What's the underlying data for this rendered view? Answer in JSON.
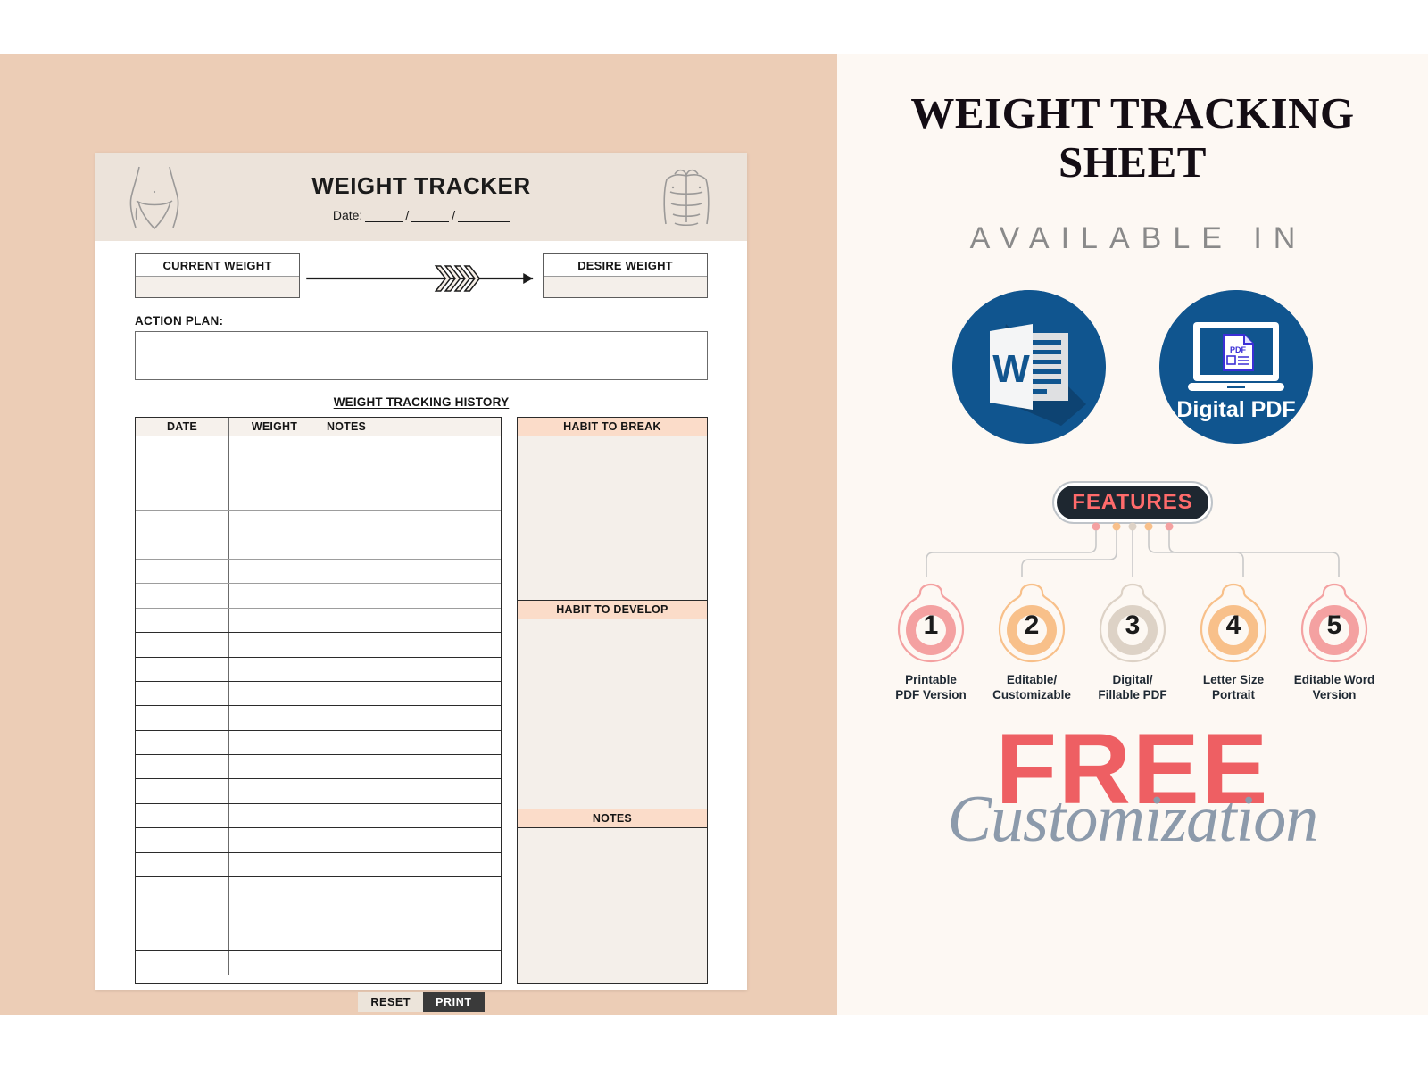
{
  "sheet": {
    "title": "WEIGHT TRACKER",
    "date_label": "Date:",
    "date_sep": "/",
    "current_weight_label": "CURRENT WEIGHT",
    "desire_weight_label": "DESIRE WEIGHT",
    "action_plan_label": "ACTION PLAN:",
    "history_title": "WEIGHT TRACKING HISTORY",
    "table": {
      "columns": [
        "DATE",
        "WEIGHT",
        "NOTES"
      ],
      "row_count": 22,
      "rows": []
    },
    "side_panels": [
      {
        "caption": "HABIT TO BREAK"
      },
      {
        "caption": "HABIT TO DEVELOP"
      },
      {
        "caption": "NOTES"
      }
    ],
    "buttons": {
      "reset": "RESET",
      "print": "PRINT"
    },
    "icons": {
      "left": "female-body-silhouette-icon",
      "right": "male-abs-silhouette-icon"
    }
  },
  "promo": {
    "title_line1": "WEIGHT TRACKING",
    "title_line2": "SHEET",
    "subtitle": "AVAILABLE IN",
    "format_badges": [
      {
        "name": "word-doc-icon",
        "letter": "W",
        "label": ""
      },
      {
        "name": "digital-pdf-icon",
        "letter": "PDF",
        "label": "Digital PDF"
      }
    ],
    "features_label": "FEATURES",
    "features": [
      {
        "number": "1",
        "label_line1": "Printable",
        "label_line2": "PDF Version",
        "color": "#f4a1a1"
      },
      {
        "number": "2",
        "label_line1": "Editable/",
        "label_line2": "Customizable",
        "color": "#f8c08a"
      },
      {
        "number": "3",
        "label_line1": "Digital/",
        "label_line2": "Fillable PDF",
        "color": "#ddd2c6"
      },
      {
        "number": "4",
        "label_line1": "Letter Size",
        "label_line2": "Portrait",
        "color": "#f8c08a"
      },
      {
        "number": "5",
        "label_line1": "Editable Word",
        "label_line2": "Version",
        "color": "#f4a1a1"
      }
    ],
    "free_text": "FREE",
    "customization_text": "Customization"
  },
  "colors": {
    "panel_left_bg": "#eccdb6",
    "panel_right_bg": "#fdf8f3",
    "sheet_header_bg": "#ece3da",
    "accent_peach": "#fbdcc9",
    "fill_grey": "#f4efea",
    "brand_blue": "#10558f",
    "free_red": "#ee5f63",
    "cust_blue_grey": "#8c9aab",
    "features_pill_bg": "#1e2730",
    "features_text": "#ff6b6b"
  }
}
